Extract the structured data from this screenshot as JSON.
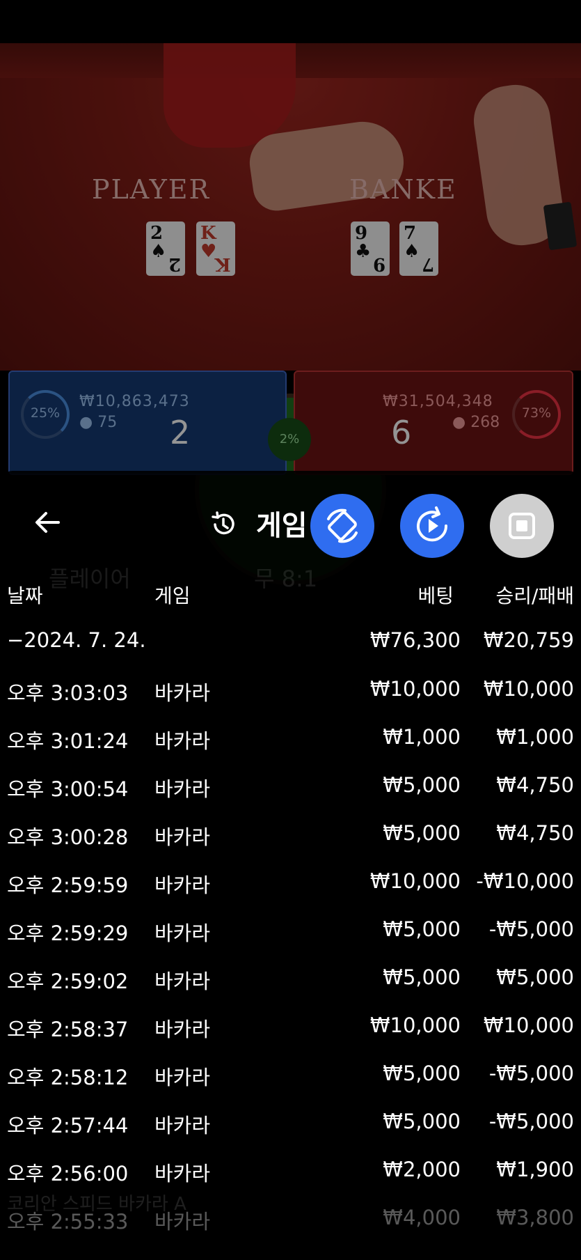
{
  "video": {
    "player_label": "PLAYER",
    "banker_label": "BANKE",
    "player_cards": [
      {
        "rank": "2",
        "suit": "♠",
        "color": "black"
      },
      {
        "rank": "K",
        "suit": "♥",
        "color": "red"
      }
    ],
    "banker_cards": [
      {
        "rank": "9",
        "suit": "♣",
        "color": "black"
      },
      {
        "rank": "7",
        "suit": "♠",
        "color": "black"
      }
    ]
  },
  "bet_panels": {
    "player": {
      "percent": "25%",
      "amount": "₩10,863,473",
      "bettors": "75",
      "score": "2"
    },
    "banker": {
      "percent": "73%",
      "amount": "₩31,504,348",
      "bettors": "268",
      "score": "6"
    },
    "tie": {
      "percent": "2%"
    }
  },
  "sheet": {
    "title": "게임",
    "columns": {
      "date": "날짜",
      "game": "게임",
      "bet": "베팅",
      "winloss": "승리/패배"
    },
    "day": {
      "label": "−2024. 7. 24.",
      "bet": "₩76,300",
      "winloss": "₩20,759"
    },
    "rows": [
      {
        "time": "오후 3:03:03",
        "game": "바카라",
        "bet": "₩10,000",
        "winloss": "₩10,000"
      },
      {
        "time": "오후 3:01:24",
        "game": "바카라",
        "bet": "₩1,000",
        "winloss": "₩1,000"
      },
      {
        "time": "오후 3:00:54",
        "game": "바카라",
        "bet": "₩5,000",
        "winloss": "₩4,750"
      },
      {
        "time": "오후 3:00:28",
        "game": "바카라",
        "bet": "₩5,000",
        "winloss": "₩4,750"
      },
      {
        "time": "오후 2:59:59",
        "game": "바카라",
        "bet": "₩10,000",
        "winloss": "-₩10,000"
      },
      {
        "time": "오후 2:59:29",
        "game": "바카라",
        "bet": "₩5,000",
        "winloss": "-₩5,000"
      },
      {
        "time": "오후 2:59:02",
        "game": "바카라",
        "bet": "₩5,000",
        "winloss": "₩5,000"
      },
      {
        "time": "오후 2:58:37",
        "game": "바카라",
        "bet": "₩10,000",
        "winloss": "₩10,000"
      },
      {
        "time": "오후 2:58:12",
        "game": "바카라",
        "bet": "₩5,000",
        "winloss": "-₩5,000"
      },
      {
        "time": "오후 2:57:44",
        "game": "바카라",
        "bet": "₩5,000",
        "winloss": "-₩5,000"
      },
      {
        "time": "오후 2:56:00",
        "game": "바카라",
        "bet": "₩2,000",
        "winloss": "₩1,900"
      },
      {
        "time": "오후 2:55:33",
        "game": "바카라",
        "bet": "₩4,000",
        "winloss": "₩3,800"
      }
    ]
  },
  "ghost_text": {
    "player": "플레이어",
    "tie": "무 8:1",
    "footer": "코리안 스피드 바카라 A"
  },
  "colors": {
    "fab_blue": "#2f6df0",
    "fab_grey": "#cfcfcf",
    "player_blue": "#3d66c1",
    "banker_red": "#b33333"
  }
}
